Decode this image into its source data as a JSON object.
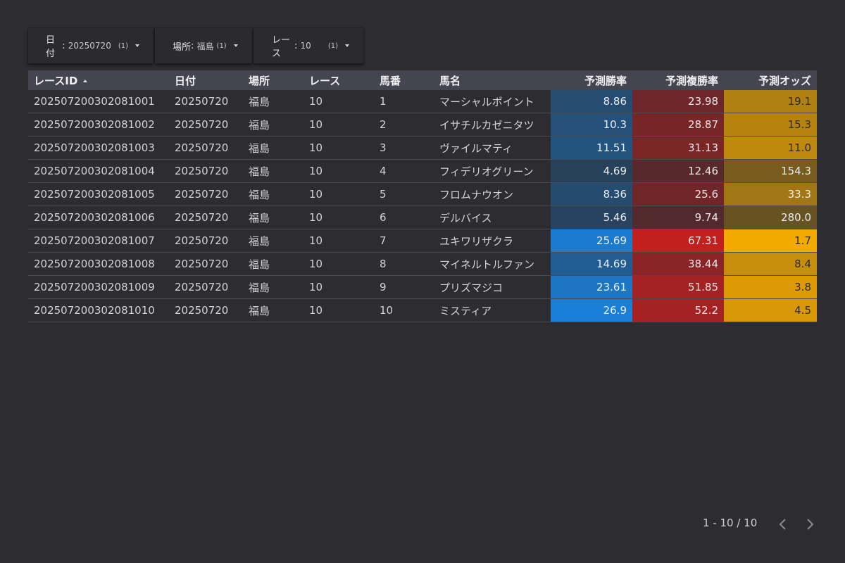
{
  "filters": [
    {
      "label": "日付",
      "value": "20250720",
      "count": "(1)"
    },
    {
      "label": "場所",
      "value": "福島",
      "count": "(1)"
    },
    {
      "label": "レース",
      "value": "10",
      "count": "(1)"
    }
  ],
  "table": {
    "headers": [
      "レースID",
      "日付",
      "場所",
      "レース",
      "馬番",
      "馬名",
      "予測勝率",
      "予測複勝率",
      "予測オッズ"
    ],
    "rows": [
      [
        "202507200302081001",
        "20250720",
        "福島",
        "10",
        "1",
        "マーシャルポイント",
        "8.86",
        "23.98",
        "19.1"
      ],
      [
        "202507200302081002",
        "20250720",
        "福島",
        "10",
        "2",
        "イサチルカゼニタツ",
        "10.3",
        "28.87",
        "15.3"
      ],
      [
        "202507200302081003",
        "20250720",
        "福島",
        "10",
        "3",
        "ヴァイルマティ",
        "11.51",
        "31.13",
        "11.0"
      ],
      [
        "202507200302081004",
        "20250720",
        "福島",
        "10",
        "4",
        "フィデリオグリーン",
        "4.69",
        "12.46",
        "154.3"
      ],
      [
        "202507200302081005",
        "20250720",
        "福島",
        "10",
        "5",
        "フロムナウオン",
        "8.36",
        "25.6",
        "33.3"
      ],
      [
        "202507200302081006",
        "20250720",
        "福島",
        "10",
        "6",
        "デルバイス",
        "5.46",
        "9.74",
        "280.0"
      ],
      [
        "202507200302081007",
        "20250720",
        "福島",
        "10",
        "7",
        "ユキワリザクラ",
        "25.69",
        "67.31",
        "1.7"
      ],
      [
        "202507200302081008",
        "20250720",
        "福島",
        "10",
        "8",
        "マイネルトルファン",
        "14.69",
        "38.44",
        "8.4"
      ],
      [
        "202507200302081009",
        "20250720",
        "福島",
        "10",
        "9",
        "プリズマジコ",
        "23.61",
        "51.85",
        "3.8"
      ],
      [
        "202507200302081010",
        "20250720",
        "福島",
        "10",
        "10",
        "ミスティア",
        "26.9",
        "52.2",
        "4.5"
      ]
    ]
  },
  "heatmap_colors": {
    "win": "#1a7fd6",
    "place": "#c21f1f",
    "odds": "#f2a900",
    "base": "#2c2c31"
  },
  "pagination": {
    "text": "1 - 10 / 10",
    "prev_icon": "chevron-left-icon",
    "next_icon": "chevron-right-icon"
  }
}
